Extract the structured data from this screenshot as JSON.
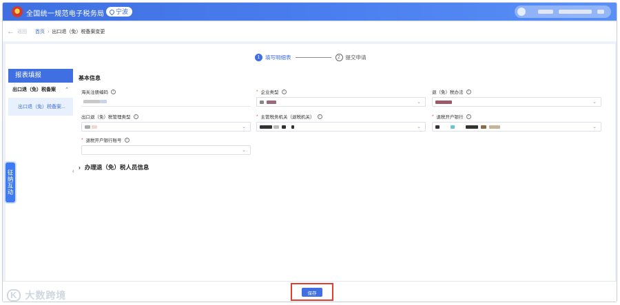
{
  "header": {
    "site_title": "全国统一规范电子税务局",
    "region": "宁波"
  },
  "breadcrumb": {
    "back_label": "返回",
    "home": "首页",
    "current": "出口退（免）税备案变更"
  },
  "steps": [
    {
      "num": "1",
      "label": "填写明细表",
      "active": true
    },
    {
      "num": "2",
      "label": "提交申请",
      "active": false
    }
  ],
  "left_panel": {
    "heading": "报表填报",
    "group_label": "出口退（免）税备案",
    "item_label": "出口退（免）税备案..."
  },
  "side_tab": "征纳互动",
  "form": {
    "section_title": "基本信息",
    "fields": [
      {
        "label": "海关注册编码",
        "required": false
      },
      {
        "label": "企业类型",
        "required": true
      },
      {
        "label": "退（免）税办法",
        "required": false
      },
      {
        "label": "出口退（免）税管理类型",
        "required": false
      },
      {
        "label": "主管税务机关（退税机关）",
        "required": true
      },
      {
        "label": "退税开户银行",
        "required": true
      },
      {
        "label": "退税开户银行账号",
        "required": true
      }
    ],
    "subsection_title": "办理退（免）税人员信息"
  },
  "footer": {
    "save_label": "保存",
    "watermark_text": "大数跨境",
    "watermark_logo": "K"
  },
  "colors": {
    "brand_blue": "#3f6fe0",
    "highlight_red": "#e23b32"
  }
}
